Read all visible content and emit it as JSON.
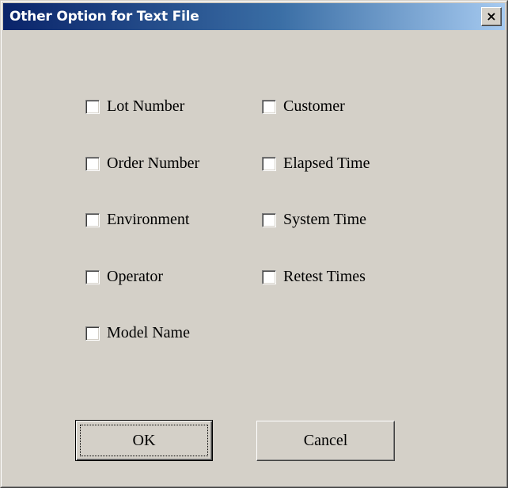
{
  "window": {
    "title": "Other Option  for Text File",
    "close_glyph": "×"
  },
  "options": {
    "left": [
      {
        "label": "Lot Number",
        "checked": false
      },
      {
        "label": "Order Number",
        "checked": false
      },
      {
        "label": "Environment",
        "checked": false
      },
      {
        "label": "Operator",
        "checked": false
      },
      {
        "label": "Model Name",
        "checked": false
      }
    ],
    "right": [
      {
        "label": "Customer",
        "checked": false
      },
      {
        "label": "Elapsed Time",
        "checked": false
      },
      {
        "label": "System Time",
        "checked": false
      },
      {
        "label": "Retest Times",
        "checked": false
      }
    ]
  },
  "buttons": {
    "ok": "OK",
    "cancel": "Cancel"
  },
  "colors": {
    "dialog_bg": "#d4d0c8",
    "title_start": "#0a246a",
    "title_end": "#a6caf0"
  }
}
